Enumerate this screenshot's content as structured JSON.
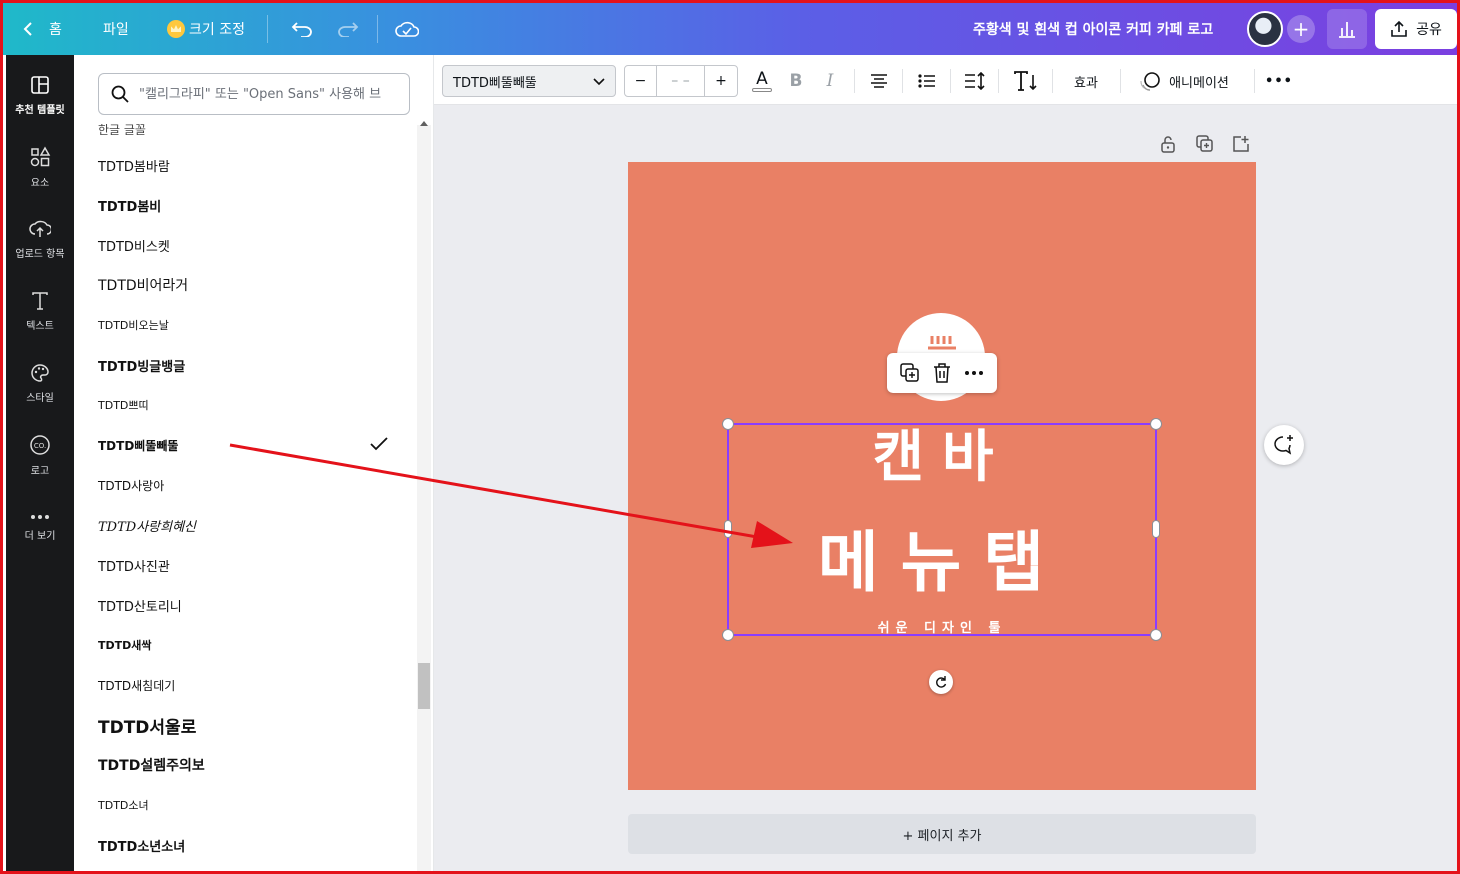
{
  "topbar": {
    "home_label": "홈",
    "file_label": "파일",
    "resize_label": "크기 조정",
    "doc_title": "주황색 및 흰색 컵 아이콘 커피 카페 로고",
    "share_label": "공유",
    "plus_label": "+"
  },
  "rail": {
    "items": [
      {
        "label": "추천 템플릿",
        "icon": "layout-icon"
      },
      {
        "label": "요소",
        "icon": "elements-icon"
      },
      {
        "label": "업로드 항목",
        "icon": "upload-cloud-icon"
      },
      {
        "label": "텍스트",
        "icon": "text-icon"
      },
      {
        "label": "스타일",
        "icon": "palette-icon"
      },
      {
        "label": "로고",
        "icon": "logo-icon"
      },
      {
        "label": "더 보기",
        "icon": "more-dots-icon"
      }
    ]
  },
  "font_panel": {
    "search_placeholder": "\"캘리그라피\" 또는 \"Open Sans\" 사용해 브",
    "category": "한글 글꼴",
    "fonts": [
      "TDTD봄바람",
      "TDTD봄비",
      "TDTD비스켓",
      "TDTD비어라거",
      "TDTD비오는날",
      "TDTD빙글뱅글",
      "TDTD쁘띠",
      "TDTD삐뚤빼뚤",
      "TDTD사랑아",
      "TDTD사랑희혜신",
      "TDTD사진관",
      "TDTD산토리니",
      "TDTD새싹",
      "TDTD새침데기",
      "TDTD서울로",
      "TDTD설렘주의보",
      "TDTD소녀",
      "TDTD소년소녀"
    ],
    "selected_font": "TDTD삐뚤빼뚤"
  },
  "toolbar": {
    "font_name": "TDTD삐뚤빼뚤",
    "size_minus": "−",
    "size_value": "– –",
    "size_plus": "+",
    "color_letter": "A",
    "bold_letter": "B",
    "italic_letter": "I",
    "effects_label": "효과",
    "animation_label": "애니메이션",
    "more_label": "•••"
  },
  "canvas": {
    "line1": "캔바",
    "line2": "메뉴탭",
    "line3": "쉬운 디자인 툴",
    "background_color": "#e98065",
    "selection_color": "#8b3dff"
  },
  "add_page_label": "+ 페이지 추가",
  "annotation": {
    "arrow_color": "#e4121a"
  }
}
